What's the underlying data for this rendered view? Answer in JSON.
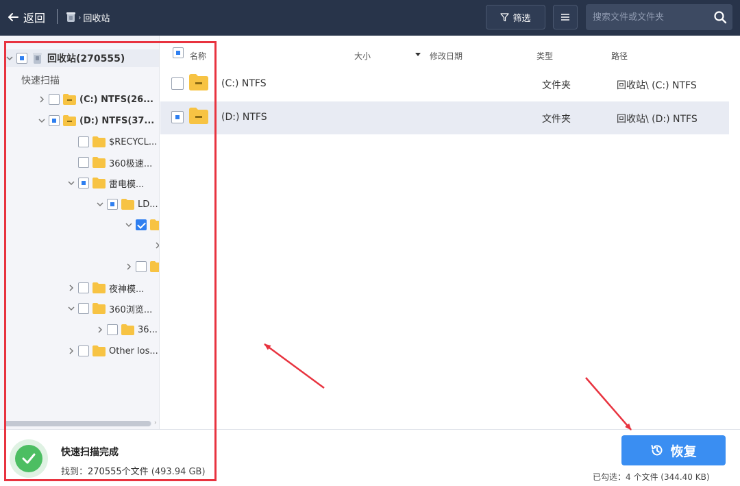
{
  "topbar": {
    "back_label": "返回",
    "breadcrumb": "回收站",
    "filter_label": "筛选",
    "search_placeholder": "搜索文件或文件夹"
  },
  "tree": {
    "root": {
      "label": "回收站(270555)",
      "check": "partial",
      "expanded": true
    },
    "section_label": "快速扫描",
    "nodes": [
      {
        "label": "(C:) NTFS(26...",
        "check": "none",
        "expanded": false
      },
      {
        "label": "(D:) NTFS(37...",
        "check": "partial",
        "expanded": true
      },
      {
        "label": "$RECYCL...",
        "check": "none"
      },
      {
        "label": "360极速...",
        "check": "none"
      },
      {
        "label": "雷电模...",
        "check": "partial",
        "expanded": true
      },
      {
        "label": "LD...",
        "check": "partial",
        "expanded": true
      },
      {
        "label": "",
        "check": "checked",
        "expanded": true
      },
      {
        "label": "",
        "check": "none",
        "expanded": false
      },
      {
        "label": "夜神模...",
        "check": "none",
        "expanded": false
      },
      {
        "label": "360浏览...",
        "check": "none",
        "expanded": true
      },
      {
        "label": "36...",
        "check": "none",
        "expanded": false
      },
      {
        "label": "Other los...",
        "check": "none",
        "expanded": false
      }
    ]
  },
  "file_list": {
    "columns": {
      "name": "名称",
      "size": "大小",
      "date": "修改日期",
      "type": "类型",
      "path": "路径"
    },
    "rows": [
      {
        "name": "(C:) NTFS",
        "type": "文件夹",
        "path": "回收站\\ (C:) NTFS",
        "check": "none",
        "selected": false
      },
      {
        "name": "(D:) NTFS",
        "type": "文件夹",
        "path": "回收站\\ (D:) NTFS",
        "check": "partial",
        "selected": true
      }
    ]
  },
  "status": {
    "title": "快速扫描完成",
    "found_prefix": "找到：",
    "found_count": "270555个文件",
    "found_size": "(493.94 GB)"
  },
  "actions": {
    "recover_label": "恢复",
    "selected_info": "已勾选：4 个文件 (344.40 KB)"
  },
  "colors": {
    "topbar_bg": "#28344a",
    "accent_blue": "#3a8ef2",
    "checkbox_blue": "#2f7ff0",
    "success_green": "#4cbe62",
    "annotation_red": "#e8333f",
    "folder_yellow": "#f7c343"
  },
  "icons": [
    "arrow-left-icon",
    "recycle-bin-icon",
    "filter-icon",
    "menu-icon",
    "search-icon",
    "chevron-right-icon",
    "chevron-down-icon",
    "folder-icon",
    "drive-folder-icon",
    "checkmark-icon",
    "history-icon"
  ]
}
